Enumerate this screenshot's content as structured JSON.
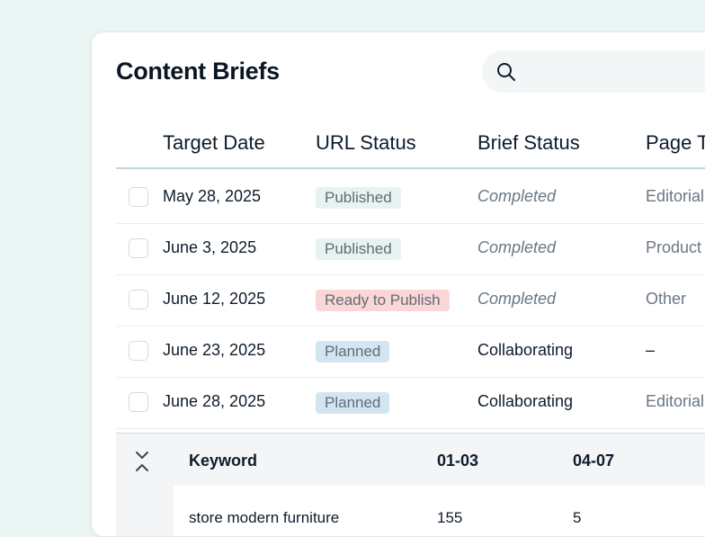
{
  "page": {
    "title": "Content Briefs"
  },
  "search": {
    "placeholder": "",
    "icon": "search-icon"
  },
  "table": {
    "columns": [
      "Target Date",
      "URL Status",
      "Brief Status",
      "Page T"
    ],
    "rows": [
      {
        "date": "May 28, 2025",
        "url_status": "Published",
        "url_kind": "published",
        "brief_status": "Completed",
        "brief_style": "italic",
        "page_type": "Editorial"
      },
      {
        "date": "June 3, 2025",
        "url_status": "Published",
        "url_kind": "published",
        "brief_status": "Completed",
        "brief_style": "italic",
        "page_type": "Product"
      },
      {
        "date": "June 12, 2025",
        "url_status": "Ready to Publish",
        "url_kind": "ready",
        "brief_status": "Completed",
        "brief_style": "italic",
        "page_type": "Other"
      },
      {
        "date": "June 23, 2025",
        "url_status": "Planned",
        "url_kind": "planned",
        "brief_status": "Collaborating",
        "brief_style": "normal",
        "page_type": "–"
      },
      {
        "date": "June 28, 2025",
        "url_status": "Planned",
        "url_kind": "planned",
        "brief_status": "Collaborating",
        "brief_style": "normal",
        "page_type": "Editorial"
      }
    ]
  },
  "keywords": {
    "headers": {
      "keyword": "Keyword",
      "col1": "01-03",
      "col2": "04-07"
    },
    "rows": [
      {
        "keyword": "store modern furniture",
        "col1": "155",
        "col2": "5"
      }
    ]
  },
  "colors": {
    "background": "#eaf5f4",
    "published": "#e6f3ef",
    "ready": "#fbd6d6",
    "planned": "#d3e5f1"
  }
}
